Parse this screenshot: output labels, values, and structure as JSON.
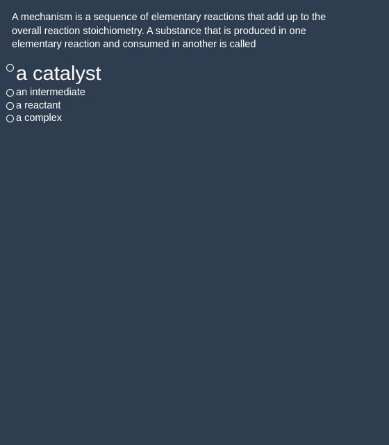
{
  "question": {
    "text": "A mechanism is a sequence of elementary reactions that add up to the overall reaction stoichiometry. A substance that is produced in one elementary reaction and consumed in another is called"
  },
  "options": [
    {
      "label": "a catalyst",
      "selected": false
    },
    {
      "label": "an intermediate",
      "selected": false
    },
    {
      "label": "a reactant",
      "selected": false
    },
    {
      "label": "a complex",
      "selected": false
    }
  ],
  "colors": {
    "background": "#2e3e50",
    "text": "#ffffff"
  }
}
